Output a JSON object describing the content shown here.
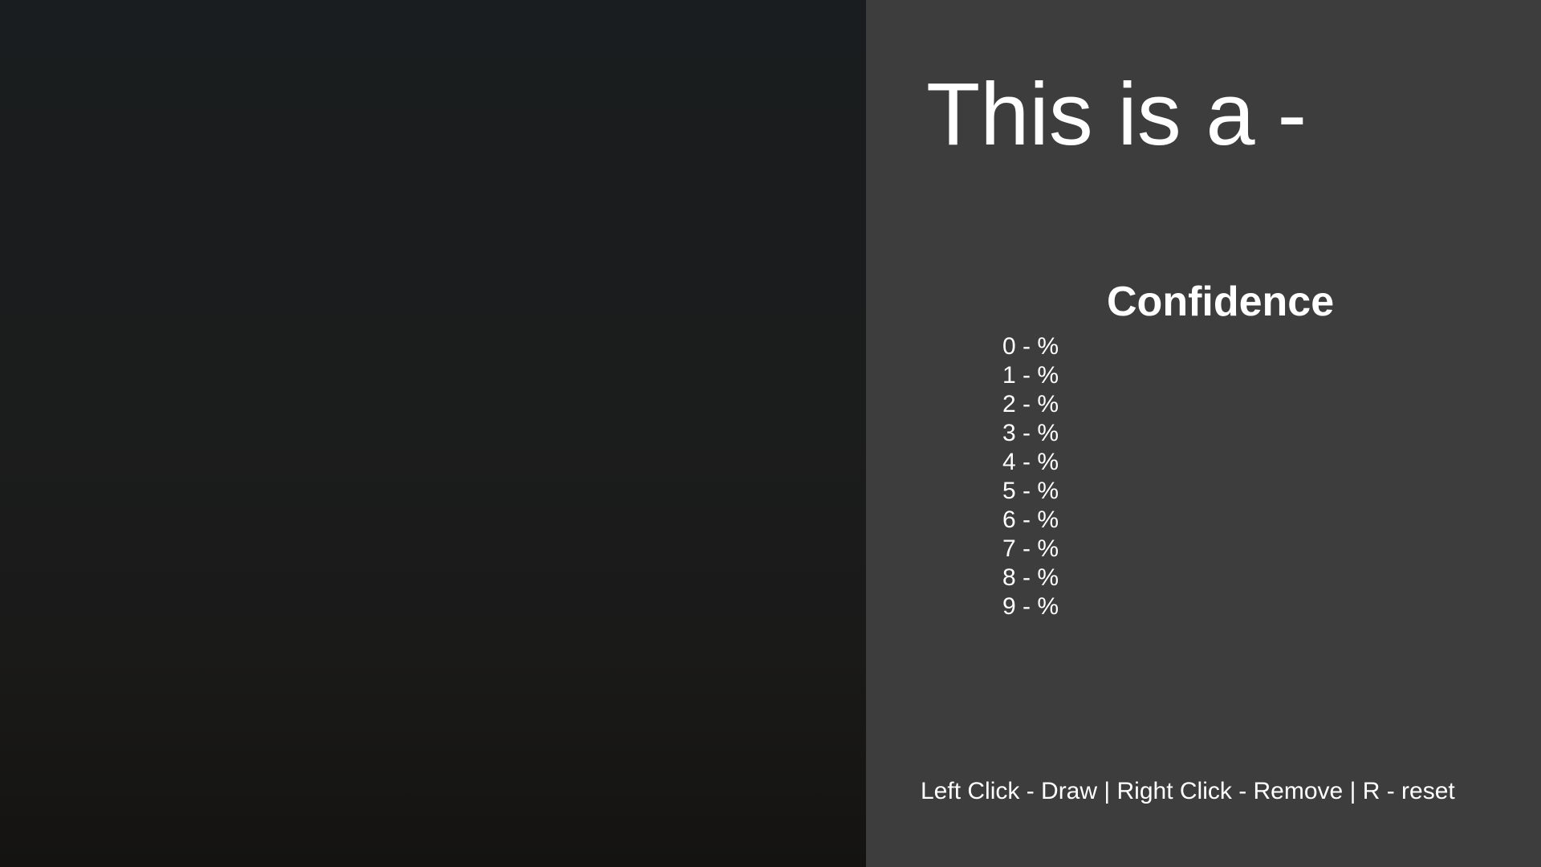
{
  "colors": {
    "canvas_background": "#1a1c1c",
    "panel_background": "#3d3d3d",
    "text": "#ffffff"
  },
  "prediction": {
    "label": "This is a",
    "value": "-"
  },
  "confidence": {
    "title": "Confidence",
    "items": [
      "0 - %",
      "1 - %",
      "2 - %",
      "3 - %",
      "4 - %",
      "5 - %",
      "6 - %",
      "7 - %",
      "8 - %",
      "9 - %"
    ]
  },
  "controls_hint": "Left Click - Draw | Right Click - Remove | R - reset"
}
